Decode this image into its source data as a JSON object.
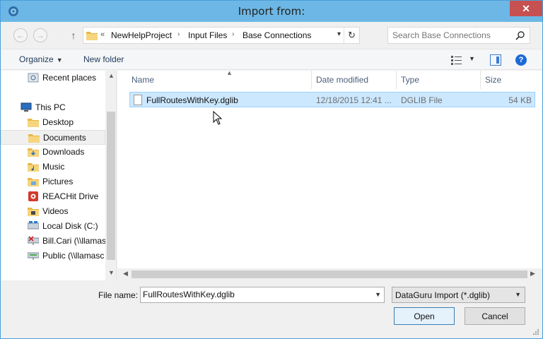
{
  "window": {
    "title": "Import from:",
    "close_label": "✕"
  },
  "nav": {
    "back_icon": "arrow-left-icon",
    "forward_icon": "arrow-right-icon",
    "up_icon": "arrow-up-icon"
  },
  "address": {
    "overflow": "«",
    "crumbs": [
      "NewHelpProject",
      "Input Files",
      "Base Connections"
    ]
  },
  "search": {
    "placeholder": "Search Base Connections"
  },
  "toolbar": {
    "organize_label": "Organize",
    "new_folder_label": "New folder",
    "help_label": "?"
  },
  "sidebar": {
    "items": [
      {
        "label": "Recent places",
        "icon": "recent-places-icon"
      },
      {
        "label": "This PC",
        "icon": "computer-icon"
      },
      {
        "label": "Desktop",
        "icon": "folder-icon"
      },
      {
        "label": "Documents",
        "icon": "folder-icon"
      },
      {
        "label": "Downloads",
        "icon": "downloads-folder-icon"
      },
      {
        "label": "Music",
        "icon": "music-folder-icon"
      },
      {
        "label": "Pictures",
        "icon": "pictures-folder-icon"
      },
      {
        "label": "REACHit Drive",
        "icon": "reachit-drive-icon"
      },
      {
        "label": "Videos",
        "icon": "videos-folder-icon"
      },
      {
        "label": "Local Disk (C:)",
        "icon": "drive-icon"
      },
      {
        "label": "Bill.Cari (\\\\llamas",
        "icon": "disconnected-network-drive-icon"
      },
      {
        "label": "Public (\\\\llamasc",
        "icon": "network-drive-icon"
      }
    ]
  },
  "filelist": {
    "columns": [
      "Name",
      "Date modified",
      "Type",
      "Size"
    ],
    "rows": [
      {
        "name": "FullRoutesWithKey.dglib",
        "date": "12/18/2015 12:41 ...",
        "type": "DGLIB File",
        "size": "54 KB"
      }
    ]
  },
  "bottom": {
    "filename_label": "File name:",
    "filename_value": "FullRoutesWithKey.dglib",
    "filetype_value": "DataGuru Import (*.dglib)",
    "open_label": "Open",
    "cancel_label": "Cancel"
  },
  "colors": {
    "titlebar": "#6cb7e5",
    "close": "#c75050",
    "selection": "#cce8ff"
  }
}
